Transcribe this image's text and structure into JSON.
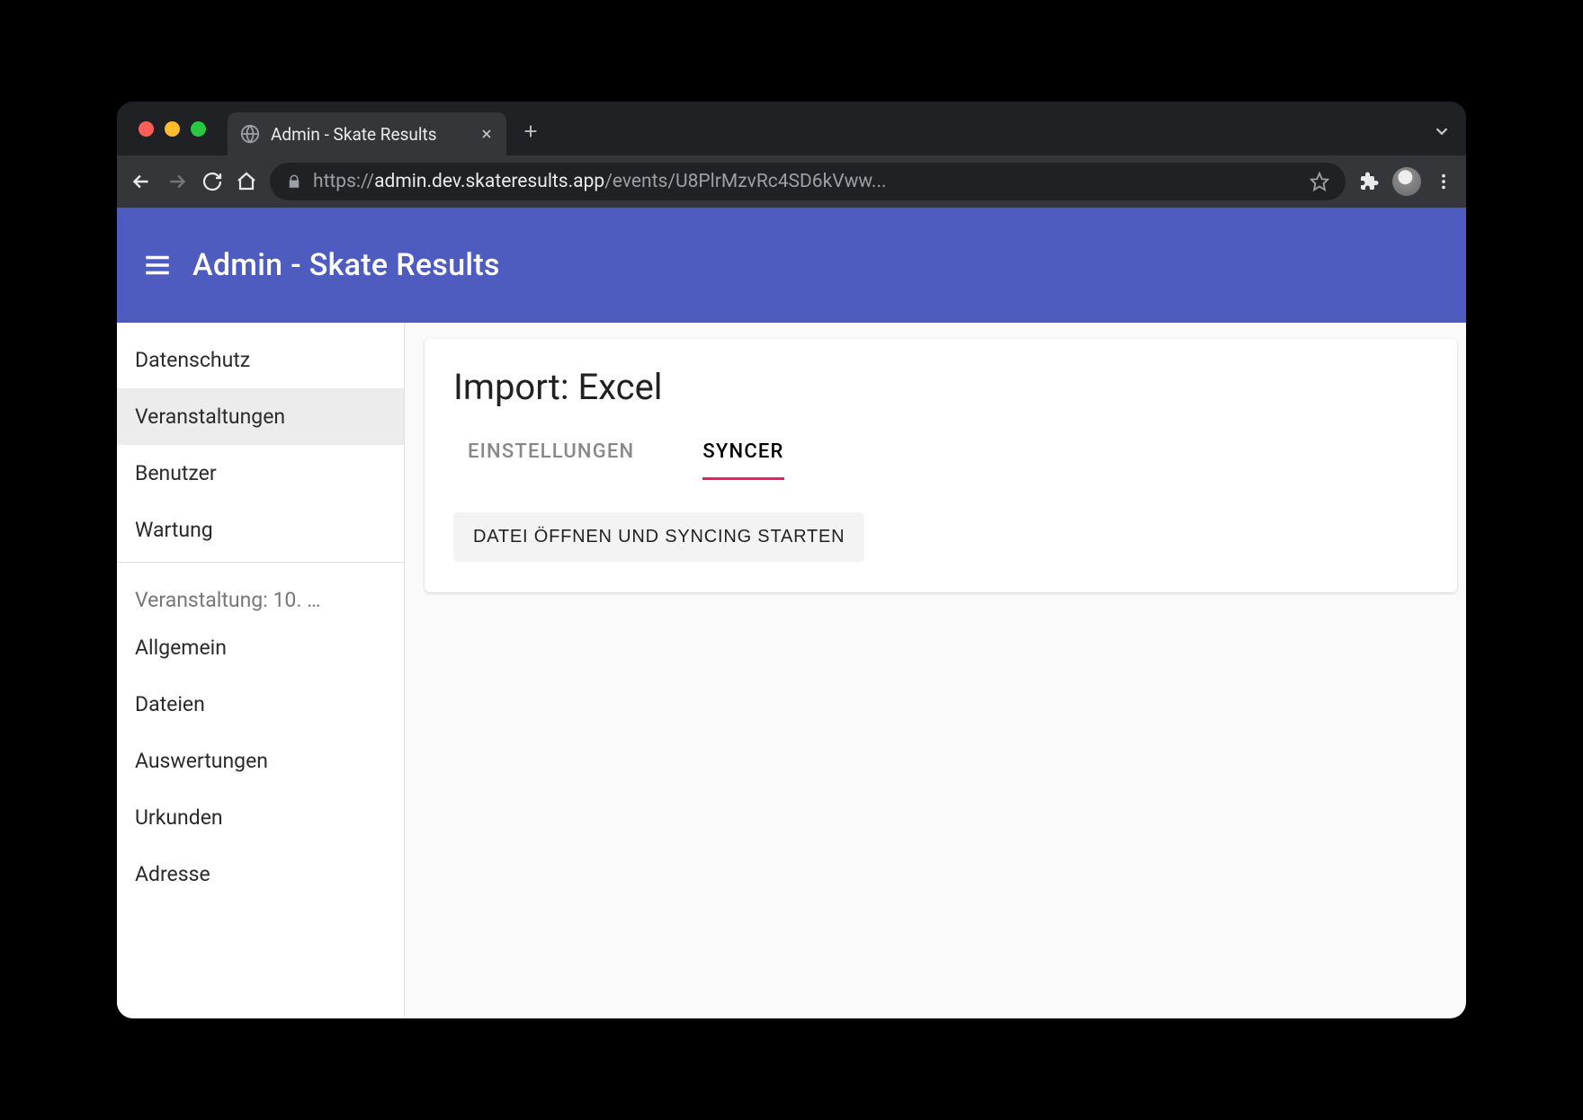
{
  "browser": {
    "tab_title": "Admin - Skate Results",
    "url_protocol": "https://",
    "url_domain": "admin.dev.skateresults.app",
    "url_path": "/events/U8PlrMzvRc4SD6kVww..."
  },
  "app": {
    "title": "Admin - Skate Results"
  },
  "sidebar": {
    "items_top": [
      "Datenschutz",
      "Veranstaltungen",
      "Benutzer",
      "Wartung"
    ],
    "section_header": "Veranstaltung: 10. …",
    "items_event": [
      "Allgemein",
      "Dateien",
      "Auswertungen",
      "Urkunden",
      "Adresse"
    ]
  },
  "main": {
    "card_title": "Import: Excel",
    "tabs": [
      "EINSTELLUNGEN",
      "SYNCER"
    ],
    "action_button": "DATEI ÖFFNEN UND SYNCING STARTEN"
  }
}
